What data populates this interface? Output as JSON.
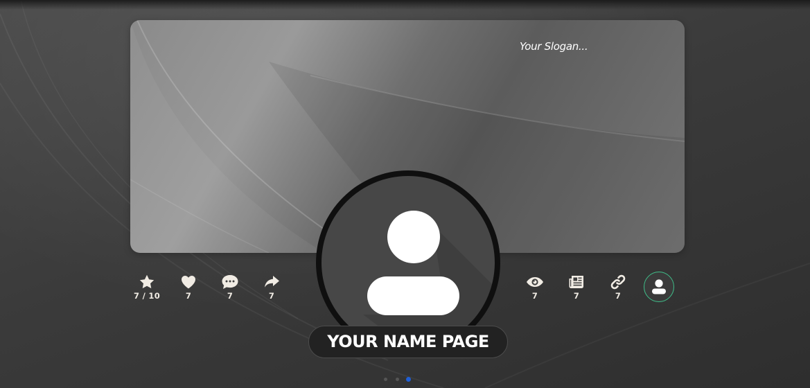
{
  "header": {
    "slogan": "Your Slogan...",
    "page_name": "YOUR NAME PAGE"
  },
  "stats_left": [
    {
      "icon": "star-icon",
      "value": "7 / 10"
    },
    {
      "icon": "heart-icon",
      "value": "7"
    },
    {
      "icon": "comment-icon",
      "value": "7"
    },
    {
      "icon": "share-icon",
      "value": "7"
    }
  ],
  "stats_right": [
    {
      "icon": "eye-icon",
      "value": "7"
    },
    {
      "icon": "newspaper-icon",
      "value": "7"
    },
    {
      "icon": "link-icon",
      "value": "7"
    }
  ],
  "profile_button": {
    "icon": "user-icon",
    "border_color": "#3fbf8a"
  },
  "avatar": {
    "icon": "user-placeholder-icon"
  },
  "pagination": {
    "count": 3,
    "active_index": 2,
    "active_color": "#1f5fd6"
  },
  "colors": {
    "icon_color": "#f1ece4",
    "background": "#3b3b3b"
  }
}
